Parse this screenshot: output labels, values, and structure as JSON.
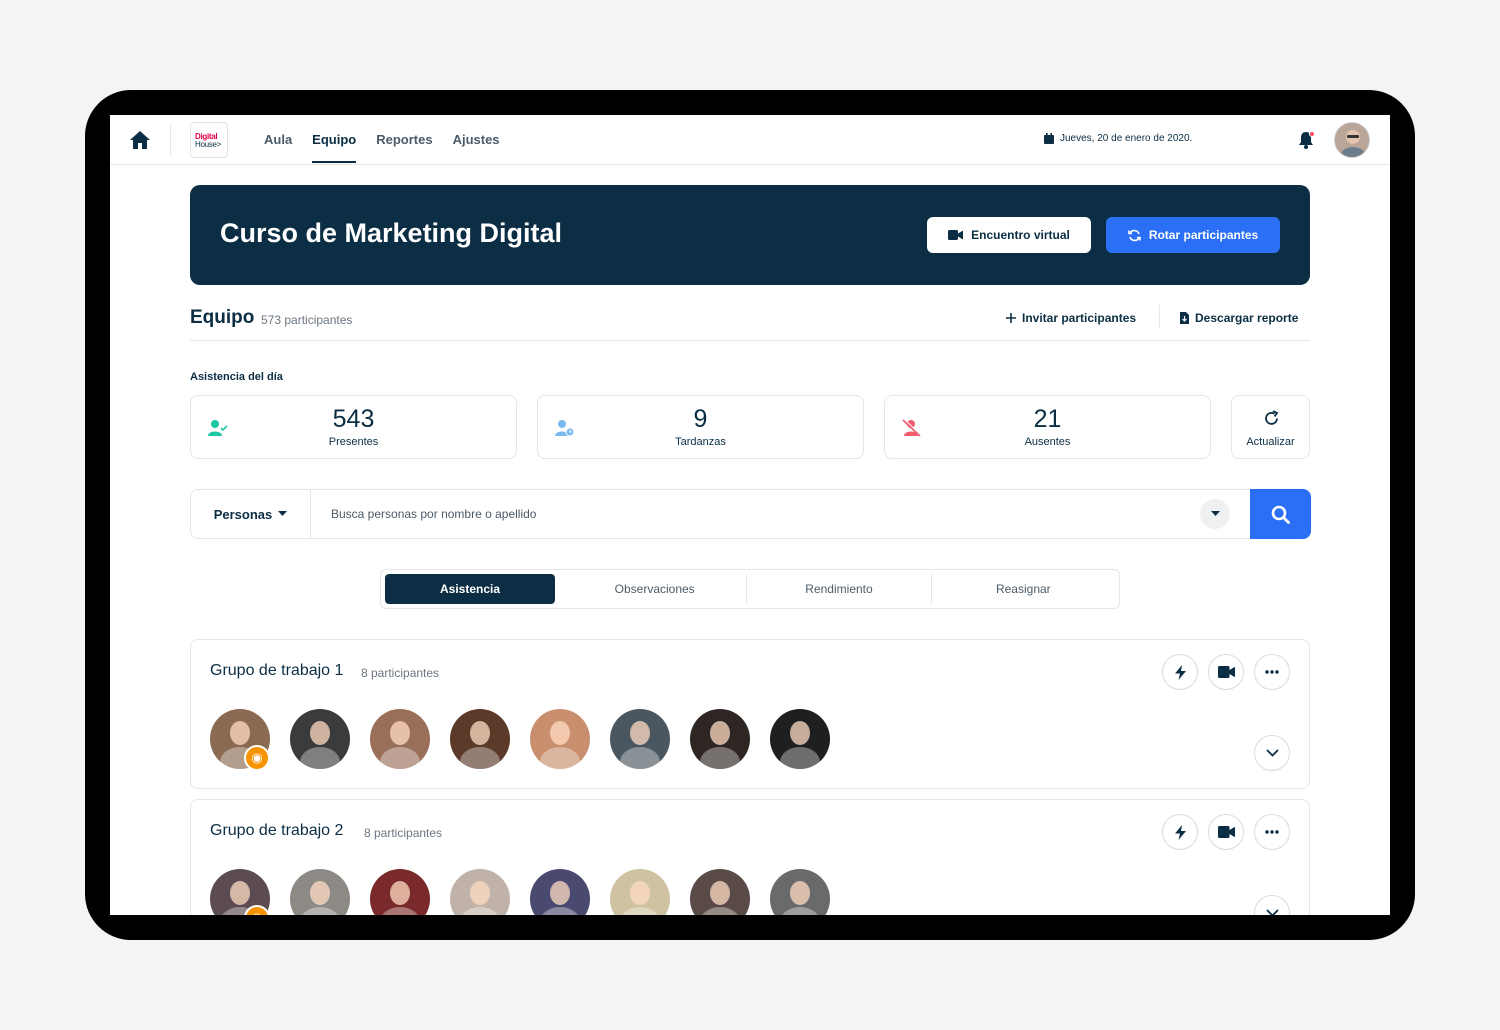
{
  "nav": {
    "logo_line1": "Digital",
    "logo_line2": "House>",
    "items": [
      {
        "label": "Aula",
        "active": false
      },
      {
        "label": "Equipo",
        "active": true
      },
      {
        "label": "Reportes",
        "active": false
      },
      {
        "label": "Ajustes",
        "active": false
      }
    ],
    "date": "Jueves, 20 de enero de 2020."
  },
  "banner": {
    "title": "Curso de Marketing Digital",
    "virtual_label": "Encuentro virtual",
    "rotate_label": "Rotar participantes"
  },
  "team": {
    "title": "Equipo",
    "count": "573 participantes",
    "invite_label": "Invitar participantes",
    "download_label": "Descargar reporte"
  },
  "attendance": {
    "label": "Asistencia del día",
    "present": {
      "value": "543",
      "label": "Presentes"
    },
    "late": {
      "value": "9",
      "label": "Tardanzas"
    },
    "absent": {
      "value": "21",
      "label": "Ausentes"
    },
    "refresh_label": "Actualizar"
  },
  "search": {
    "selector_label": "Personas",
    "placeholder": "Busca personas por nombre o apellido"
  },
  "tabs": [
    "Asistencia",
    "Observaciones",
    "Rendimiento",
    "Reasignar"
  ],
  "groups": [
    {
      "title": "Grupo de trabajo 1",
      "count": "8 participantes",
      "member_colors": [
        "#8a6a52",
        "#3b3b3b",
        "#9a6f5a",
        "#5b3a2a",
        "#c98e6e",
        "#4a5660",
        "#2d2622",
        "#1f1f22"
      ]
    },
    {
      "title": "Grupo de trabajo 2",
      "count": "8 participantes",
      "member_colors": [
        "#5d4b52",
        "#8d8a86",
        "#7a2a2a",
        "#c0b2a8",
        "#4a4a70",
        "#cfc2a0",
        "#5a4a48",
        "#6a6a6a"
      ]
    }
  ],
  "colors": {
    "primary": "#0b2e44",
    "accent": "#2a6ff5",
    "present_icon": "#1fc6a3",
    "late_icon": "#7ab8f0",
    "absent_icon": "#f25c6e",
    "badge": "#f59300"
  }
}
